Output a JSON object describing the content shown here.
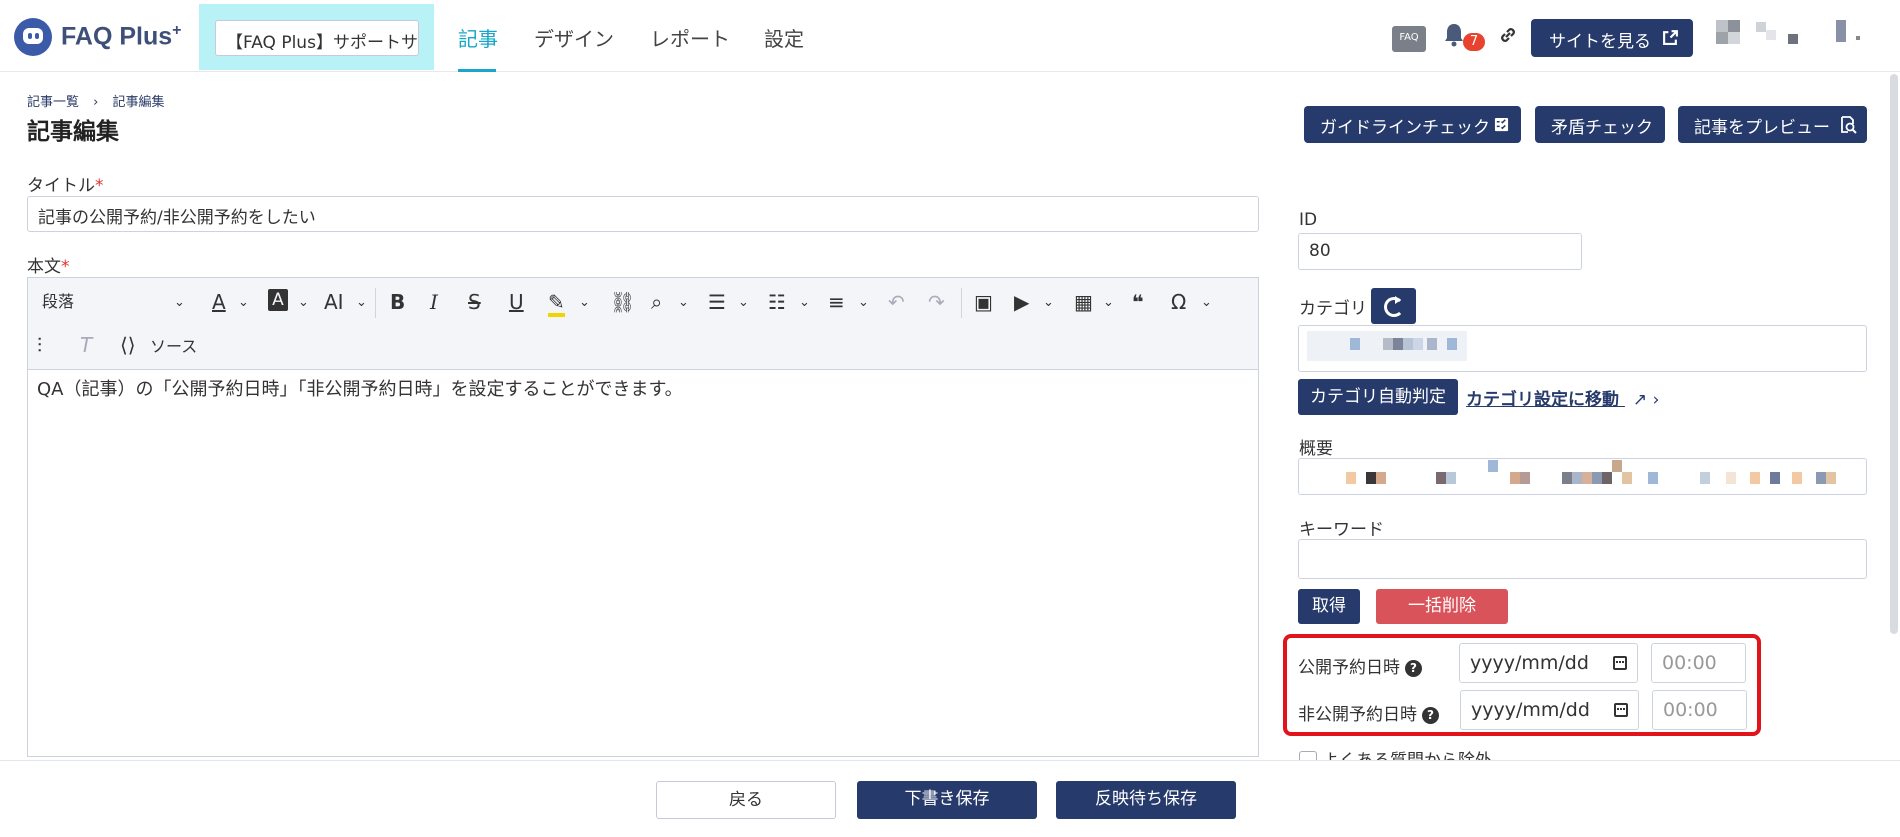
{
  "header": {
    "logo_text": "FAQ Plus",
    "logo_sup": "+",
    "site_name": "【FAQ Plus】サポートサ",
    "tabs": [
      {
        "label": "記事",
        "active": true
      },
      {
        "label": "デザイン",
        "active": false
      },
      {
        "label": "レポート",
        "active": false
      },
      {
        "label": "設定",
        "active": false
      }
    ],
    "faq_badge": "FAQ",
    "notification_count": "7",
    "view_site_label": "サイトを見る"
  },
  "breadcrumb": {
    "items": [
      "記事一覧",
      "記事編集"
    ],
    "separator": "›"
  },
  "page_title": "記事編集",
  "actions": {
    "guideline_check": "ガイドラインチェック",
    "contradiction_check": "矛盾チェック",
    "preview": "記事をプレビュー"
  },
  "form": {
    "title_label": "タイトル",
    "required_mark": "*",
    "title_value": "記事の公開予約/非公開予約をしたい",
    "body_label": "本文",
    "paragraph_style": "段落",
    "source_label": "ソース",
    "body_text": "QA（記事）の「公開予約日時」「非公開予約日時」を設定することができます。"
  },
  "side": {
    "id_label": "ID",
    "id_value": "80",
    "category_label": "カテゴリ",
    "category_auto_label": "カテゴリ自動判定",
    "category_settings_link": "カテゴリ設定に移動",
    "summary_label": "概要",
    "keyword_label": "キーワード",
    "fetch_label": "取得",
    "bulk_delete_label": "一括削除",
    "publish_label": "公開予約日時",
    "unpublish_label": "非公開予約日時",
    "date_placeholder": "yyyy/mm/dd",
    "time_placeholder": "00:00",
    "faq_exclude_label": "よくある質問から除外"
  },
  "footer": {
    "back_label": "戻る",
    "draft_label": "下書き保存",
    "pending_label": "反映待ち保存"
  },
  "colors": {
    "primary": "#263a6b",
    "accent": "#19a6c8",
    "danger": "#d9545a",
    "highlight": "#e2141b"
  }
}
